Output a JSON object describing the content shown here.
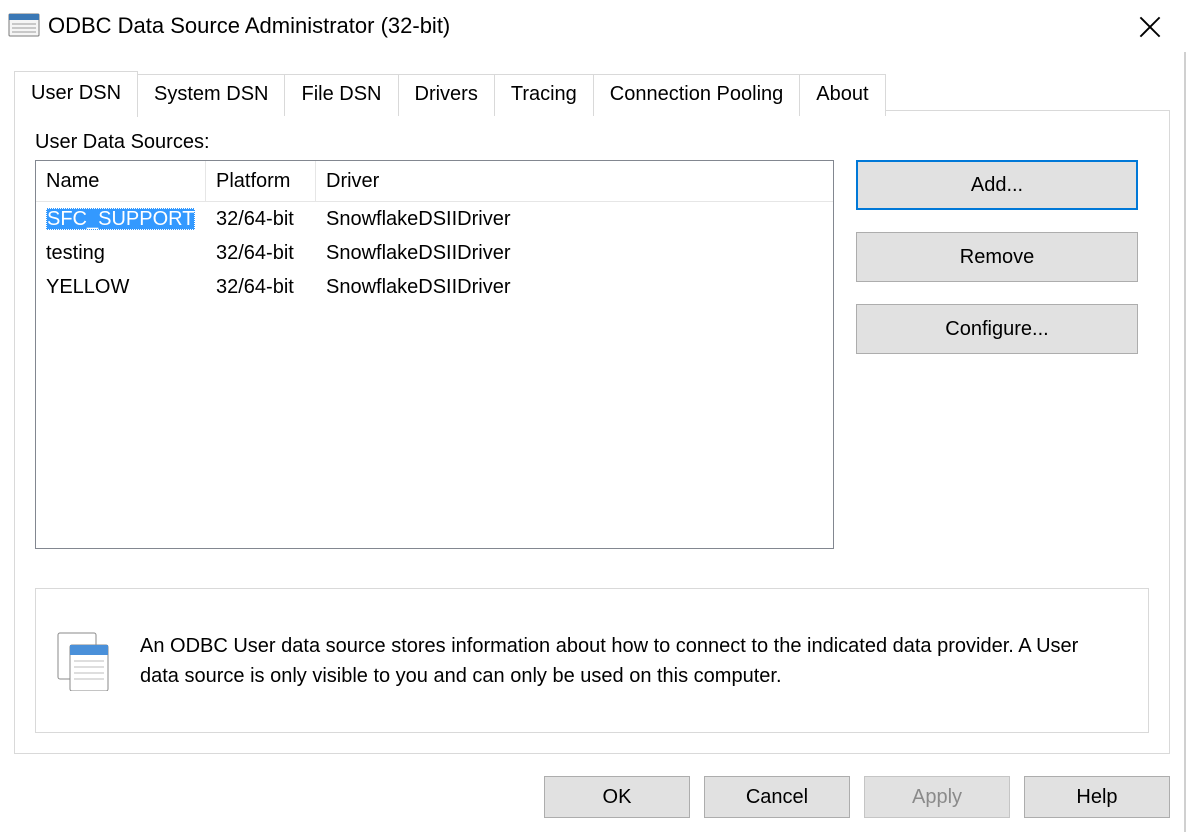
{
  "window": {
    "title": "ODBC Data Source Administrator (32-bit)"
  },
  "tabs": [
    {
      "label": "User DSN",
      "active": true
    },
    {
      "label": "System DSN",
      "active": false
    },
    {
      "label": "File DSN",
      "active": false
    },
    {
      "label": "Drivers",
      "active": false
    },
    {
      "label": "Tracing",
      "active": false
    },
    {
      "label": "Connection Pooling",
      "active": false
    },
    {
      "label": "About",
      "active": false
    }
  ],
  "panel": {
    "section_label": "User Data Sources:",
    "columns": {
      "name": "Name",
      "platform": "Platform",
      "driver": "Driver"
    },
    "rows": [
      {
        "name": "SFC_SUPPORT",
        "platform": "32/64-bit",
        "driver": "SnowflakeDSIIDriver",
        "selected": true
      },
      {
        "name": "testing",
        "platform": "32/64-bit",
        "driver": "SnowflakeDSIIDriver",
        "selected": false
      },
      {
        "name": "YELLOW",
        "platform": "32/64-bit",
        "driver": "SnowflakeDSIIDriver",
        "selected": false
      }
    ],
    "side_buttons": {
      "add": "Add...",
      "remove": "Remove",
      "configure": "Configure..."
    },
    "info_text": "An ODBC User data source stores information about how to connect to the indicated data provider.   A User data source is only visible to you and can only be used on this computer."
  },
  "bottom_buttons": {
    "ok": "OK",
    "cancel": "Cancel",
    "apply": "Apply",
    "help": "Help"
  }
}
